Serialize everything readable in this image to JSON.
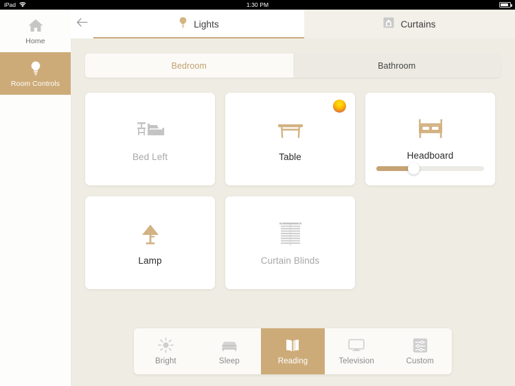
{
  "status_bar": {
    "device": "iPad",
    "wifi_icon": "wifi-icon",
    "time": "1:30 PM",
    "battery_icon": "battery-icon"
  },
  "sidebar": {
    "items": [
      {
        "label": "Home",
        "icon": "home-icon",
        "active": false
      },
      {
        "label": "Room Controls",
        "icon": "lightbulb-icon",
        "active": true
      }
    ]
  },
  "topbar": {
    "back_icon": "back-arrow-icon",
    "tabs": [
      {
        "label": "Lights",
        "icon": "lightbulb-icon",
        "active": true
      },
      {
        "label": "Curtains",
        "icon": "curtains-icon",
        "active": false
      }
    ]
  },
  "room_segment": {
    "options": [
      {
        "label": "Bedroom",
        "active": true
      },
      {
        "label": "Bathroom",
        "active": false
      }
    ]
  },
  "devices": [
    {
      "label": "Bed Left",
      "icon": "bed-side-table-icon",
      "state": "off",
      "has_slider": false,
      "has_orb": false
    },
    {
      "label": "Table",
      "icon": "table-icon",
      "state": "on",
      "has_slider": false,
      "has_orb": true
    },
    {
      "label": "Headboard",
      "icon": "bed-icon",
      "state": "on",
      "has_slider": true,
      "has_orb": false,
      "brightness": 35
    },
    {
      "label": "Lamp",
      "icon": "lamp-icon",
      "state": "on",
      "has_slider": false,
      "has_orb": false
    },
    {
      "label": "Curtain Blinds",
      "icon": "blinds-icon",
      "state": "off",
      "has_slider": false,
      "has_orb": false
    }
  ],
  "scenes": [
    {
      "label": "Bright",
      "icon": "sun-icon",
      "active": false
    },
    {
      "label": "Sleep",
      "icon": "bed-icon",
      "active": false
    },
    {
      "label": "Reading",
      "icon": "open-book-icon",
      "active": true
    },
    {
      "label": "Television",
      "icon": "monitor-icon",
      "active": false
    },
    {
      "label": "Custom",
      "icon": "sliders-icon",
      "active": false
    }
  ],
  "colors": {
    "accent": "#cdab79",
    "accent_text": "#c3a06d",
    "background": "#efece4",
    "card": "#ffffff",
    "inactive_icon": "#c4c4c4",
    "inactive_text": "#a7a7a7"
  }
}
